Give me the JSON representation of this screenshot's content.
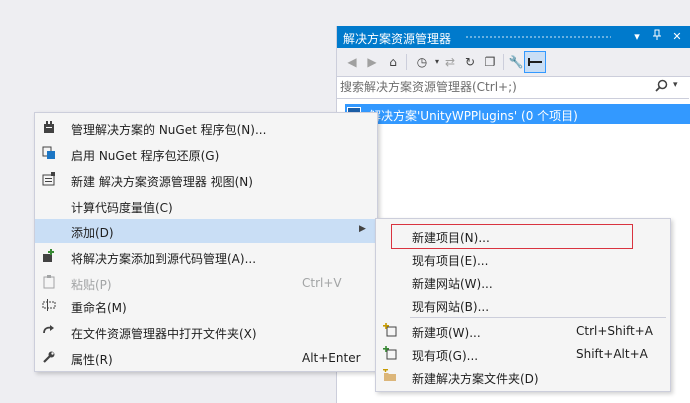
{
  "solution_explorer": {
    "title": "解决方案资源管理器",
    "title_buttons": [
      "▾",
      "ᵖ",
      "✕"
    ],
    "search": {
      "placeholder": "搜索解决方案资源管理器(Ctrl+;)",
      "value": ""
    },
    "solution_label": "解决方案'UnityWPPlugins' (0 个项目)",
    "colors": {
      "title_bar": "#007acc",
      "selection": "#3399ff"
    }
  },
  "context_menu": {
    "items": [
      {
        "label": "管理解决方案的 NuGet 程序包(N)...",
        "icon": "nuget-package-icon"
      },
      {
        "label": "启用 NuGet 程序包还原(G)",
        "icon": "package-restore-icon"
      },
      {
        "label": "新建 解决方案资源管理器 视图(N)",
        "icon": "new-view-icon"
      },
      {
        "label": "计算代码度量值(C)",
        "icon": ""
      },
      {
        "label": "添加(D)",
        "icon": "",
        "has_submenu": true
      },
      {
        "label": "将解决方案添加到源代码管理(A)...",
        "icon": "source-control-icon"
      },
      {
        "label": "粘贴(P)",
        "shortcut": "Ctrl+V",
        "icon": "paste-icon",
        "disabled": true
      },
      {
        "label": "重命名(M)",
        "icon": "rename-icon"
      },
      {
        "label": "在文件资源管理器中打开文件夹(X)",
        "icon": "open-folder-icon"
      },
      {
        "label": "属性(R)",
        "shortcut": "Alt+Enter",
        "icon": "wrench-icon"
      }
    ]
  },
  "submenu": {
    "items": [
      {
        "label": "新建项目(N)..."
      },
      {
        "label": "现有项目(E)..."
      },
      {
        "label": "新建网站(W)..."
      },
      {
        "label": "现有网站(B)..."
      },
      {
        "label": "新建项(W)...",
        "shortcut": "Ctrl+Shift+A",
        "icon": "new-item-icon"
      },
      {
        "label": "现有项(G)...",
        "shortcut": "Shift+Alt+A",
        "icon": "existing-item-icon"
      },
      {
        "label": "新建解决方案文件夹(D)",
        "icon": "solution-folder-icon"
      }
    ],
    "highlight_color": "#d9333f"
  }
}
